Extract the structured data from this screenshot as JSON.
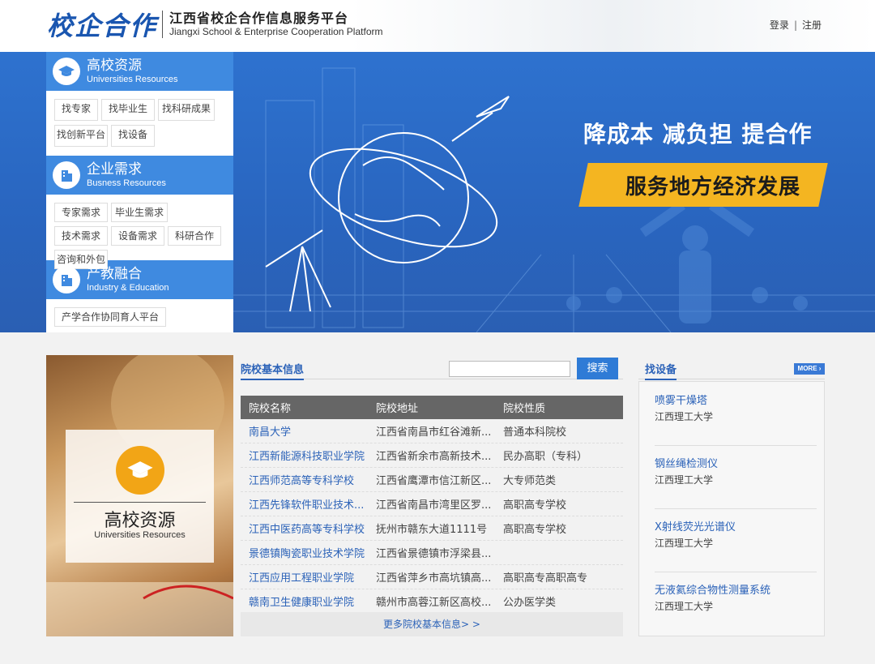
{
  "header": {
    "logo_calligraphy": "校企合作",
    "logo_cn": "江西省校企合作信息服务平台",
    "logo_en": "Jiangxi School & Enterprise Cooperation Platform",
    "login": "登录",
    "separator": "|",
    "register": "注册"
  },
  "banner": {
    "slogan": "降成本  减负担  提合作",
    "ribbon": "服务地方经济发展"
  },
  "categories": [
    {
      "title": "高校资源",
      "subtitle": "Universities Resources",
      "icon": "graduation-cap-icon",
      "tags": [
        "找专家",
        "找毕业生",
        "找科研成果",
        "找创新平台",
        "找设备"
      ]
    },
    {
      "title": "企业需求",
      "subtitle": "Busness Resources",
      "icon": "building-icon",
      "tags": [
        "专家需求",
        "毕业生需求",
        "技术需求",
        "设备需求",
        "科研合作",
        "咨询和外包"
      ]
    },
    {
      "title": "产教融合",
      "subtitle": "Industry & Education",
      "icon": "building-icon",
      "tags": [
        "产学合作协同育人平台"
      ]
    }
  ],
  "promo": {
    "title": "高校资源",
    "subtitle": "Universities Resources",
    "icon": "graduation-cap-icon"
  },
  "school_info": {
    "tab_label": "院校基本信息",
    "search_placeholder": "",
    "search_button": "搜索",
    "columns": [
      "院校名称",
      "院校地址",
      "院校性质"
    ],
    "rows": [
      [
        "南昌大学",
        "江西省南昌市红谷滩新...",
        "普通本科院校"
      ],
      [
        "江西新能源科技职业学院",
        "江西省新余市高新技术...",
        "民办高职（专科）"
      ],
      [
        "江西师范高等专科学校",
        "江西省鹰潭市信江新区...",
        "大专师范类"
      ],
      [
        "江西先锋软件职业技术...",
        "江西省南昌市湾里区罗...",
        "高职高专学校"
      ],
      [
        "江西中医药高等专科学校",
        "抚州市赣东大道1111号",
        "高职高专学校"
      ],
      [
        "景德镇陶瓷职业技术学院",
        "江西省景德镇市浮梁县...",
        ""
      ],
      [
        "江西应用工程职业学院",
        "江西省萍乡市高坑镇高...",
        "高职高专高职高专"
      ],
      [
        "赣南卫生健康职业学院",
        "赣州市高蓉江新区高校...",
        "公办医学类"
      ]
    ],
    "more_link": "更多院校基本信息> >"
  },
  "equipment": {
    "tab_label": "找设备",
    "more_badge": "MORE ›",
    "items": [
      {
        "name": "喷雾干燥塔",
        "org": "江西理工大学"
      },
      {
        "name": "钢丝绳检测仪",
        "org": "江西理工大学"
      },
      {
        "name": "X射线荧光光谱仪",
        "org": "江西理工大学"
      },
      {
        "name": "无液氦综合物性测量系统",
        "org": "江西理工大学"
      }
    ]
  },
  "colors": {
    "brand_blue": "#2b62b8",
    "banner_blue": "#2e72cf",
    "category_header": "#3f8ae0",
    "ribbon_yellow": "#f4b521",
    "promo_orange": "#f2a516"
  }
}
